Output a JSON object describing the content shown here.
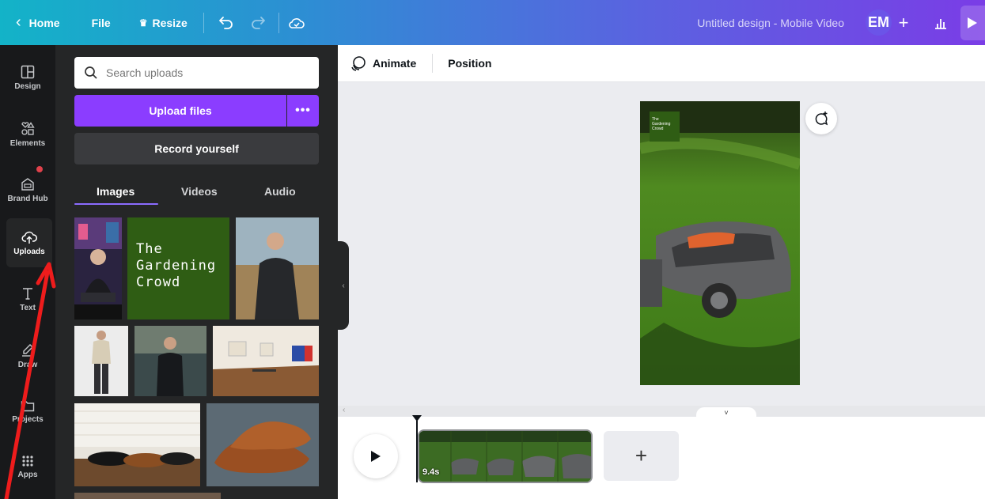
{
  "topbar": {
    "home_label": "Home",
    "file_label": "File",
    "resize_label": "Resize",
    "design_title": "Untitled design - Mobile Video",
    "avatar_initials": "EM",
    "icons": [
      "chevron-left-icon",
      "crown-icon",
      "undo-icon",
      "redo-icon",
      "cloud-saved-icon",
      "plus-icon",
      "insights-icon",
      "present-icon"
    ]
  },
  "leftnav": {
    "items": [
      {
        "label": "Design",
        "icon": "layout-icon"
      },
      {
        "label": "Elements",
        "icon": "shapes-icon"
      },
      {
        "label": "Brand Hub",
        "icon": "brand-icon"
      },
      {
        "label": "Uploads",
        "icon": "cloud-upload-icon"
      },
      {
        "label": "Text",
        "icon": "text-icon"
      },
      {
        "label": "Draw",
        "icon": "draw-icon"
      },
      {
        "label": "Projects",
        "icon": "folder-icon"
      },
      {
        "label": "Apps",
        "icon": "apps-grid-icon"
      }
    ],
    "active": "Uploads"
  },
  "panel": {
    "search_placeholder": "Search uploads",
    "upload_label": "Upload files",
    "upload_more_label": "•••",
    "record_label": "Record yourself",
    "tabs": [
      "Images",
      "Videos",
      "Audio"
    ],
    "active_tab": "Images",
    "gardening_text": "The Gardening Crowd"
  },
  "toolbar": {
    "animate_label": "Animate",
    "position_label": "Position"
  },
  "canvas": {
    "brand_tag": "The Gardening Crowd"
  },
  "timeline": {
    "clip_duration": "9.4s",
    "add_label": "+"
  },
  "colors": {
    "accent": "#8b3dff",
    "panel_bg": "#252627",
    "nav_bg": "#18191b",
    "brand_green": "#2f5d14"
  }
}
